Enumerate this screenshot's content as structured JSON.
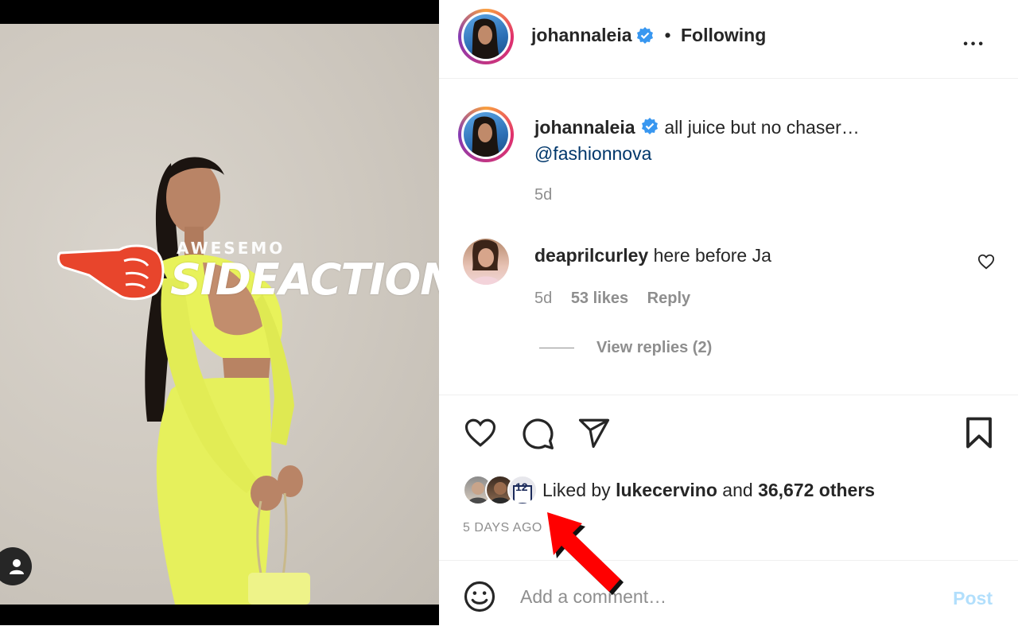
{
  "post": {
    "author": "johannaleia",
    "follow_status": "Following",
    "separator": "•",
    "more_label": "•••",
    "caption": "all juice but no chaser…",
    "caption_mention": "@fashionnova",
    "caption_time": "5d"
  },
  "watermark": {
    "top": "AWESEMO",
    "bottom": "SIDEACTION"
  },
  "comment": {
    "user": "deaprilcurley",
    "text": "here before Ja",
    "time": "5d",
    "likes": "53 likes",
    "reply": "Reply",
    "view_replies": "View replies (2)"
  },
  "likes": {
    "prefix": "Liked by",
    "user": "lukecervino",
    "middle": "and",
    "count": "36,672 others",
    "jersey_number": "12"
  },
  "timestamp": "5 DAYS AGO",
  "add_comment": {
    "placeholder": "Add a comment…",
    "post_label": "Post"
  },
  "colors": {
    "verified": "#3897f0",
    "link": "#00376b",
    "muted": "#8e8e8e",
    "post_disabled": "#b2dffc",
    "annotation_arrow": "#ff0000"
  },
  "icons": [
    "ellipsis-icon",
    "verified-icon",
    "heart-icon",
    "comment-icon",
    "share-icon",
    "bookmark-icon",
    "emoji-icon",
    "person-icon",
    "pointing-hand-icon"
  ]
}
